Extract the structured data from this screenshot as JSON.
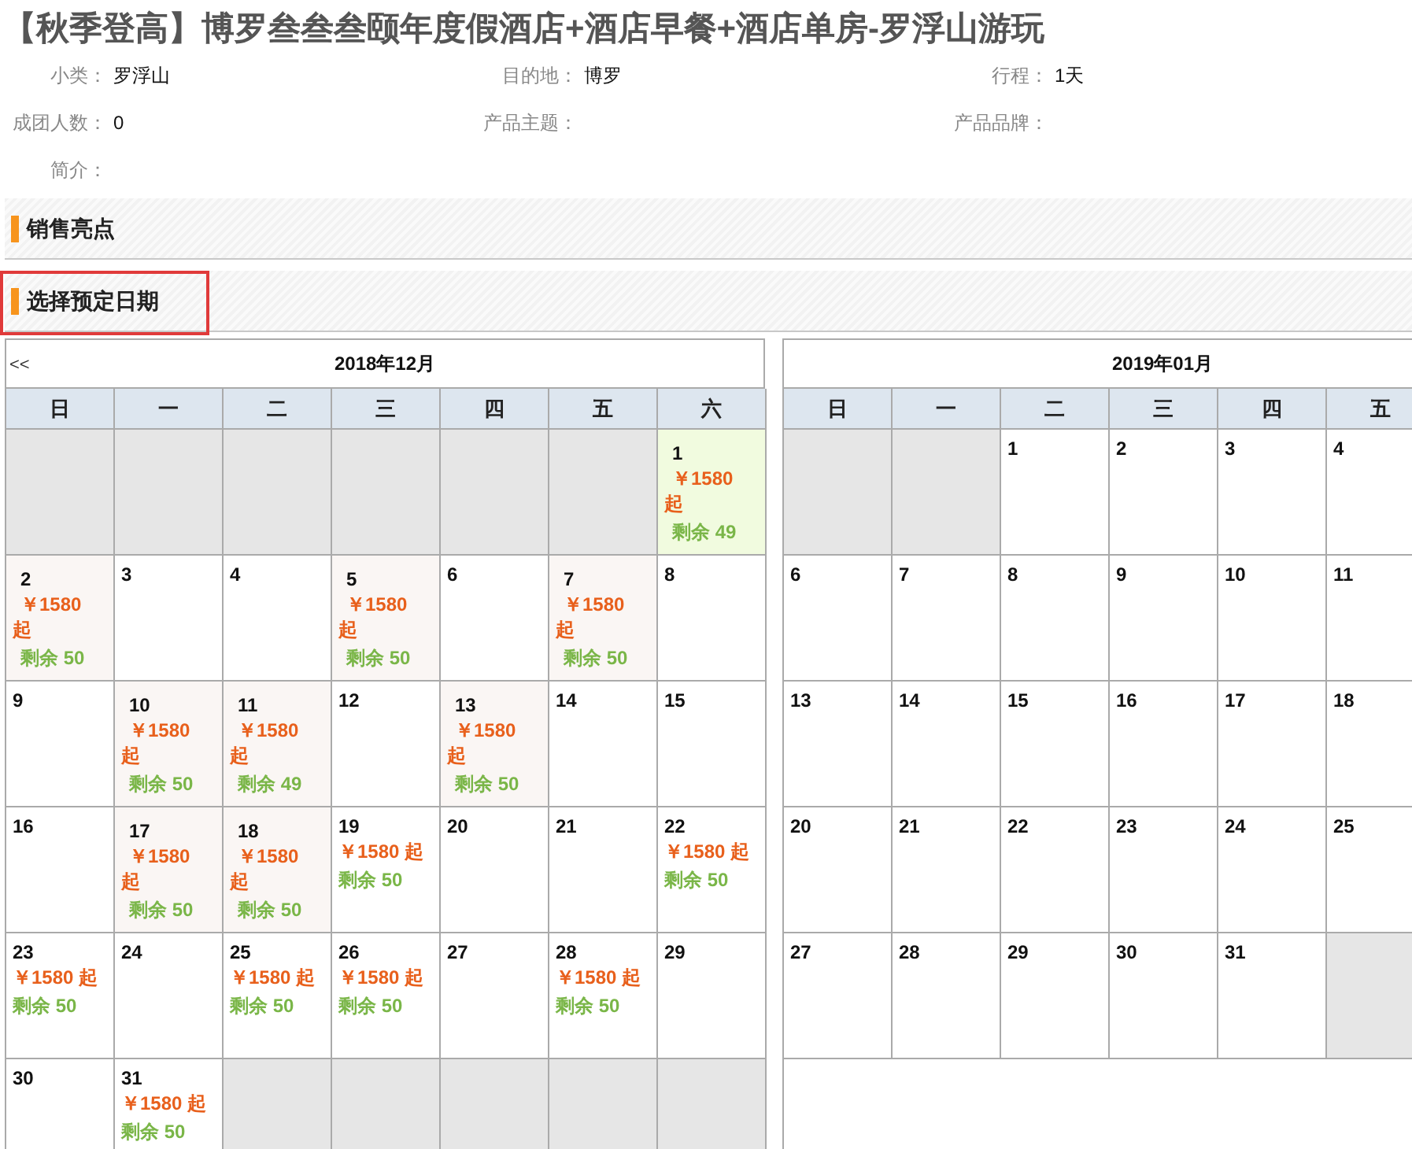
{
  "title": "【秋季登高】博罗叁叁叁颐年度假酒店+酒店早餐+酒店单房-罗浮山游玩",
  "info_rows": [
    [
      {
        "label": "小类：",
        "value": "罗浮山"
      },
      {
        "label": "目的地：",
        "value": "博罗"
      },
      {
        "label": "行程：",
        "value": "1天"
      }
    ],
    [
      {
        "label": "成团人数：",
        "value": "0"
      },
      {
        "label": "产品主题："
      },
      {
        "label": "产品品牌："
      }
    ],
    [
      {
        "label": "简介："
      }
    ]
  ],
  "sections": [
    {
      "title": "销售亮点",
      "highlighted": false
    },
    {
      "title": "选择预定日期",
      "highlighted": true
    }
  ],
  "calendars": [
    {
      "prev": "<<",
      "month": "2018年12月",
      "weekdays": [
        "日",
        "一",
        "二",
        "三",
        "四",
        "五",
        "六"
      ],
      "weeks": [
        [
          {
            "kind": "blank"
          },
          {
            "kind": "blank"
          },
          {
            "kind": "blank"
          },
          {
            "kind": "blank"
          },
          {
            "kind": "blank"
          },
          {
            "kind": "blank"
          },
          {
            "kind": "offer_boxed",
            "day": "1",
            "price": "￥1580 起",
            "stock": "剩余 49",
            "selected": true
          }
        ],
        [
          {
            "kind": "offer_boxed",
            "day": "2",
            "price": "￥1580 起",
            "stock": "剩余 50",
            "selected": false
          },
          {
            "kind": "day",
            "day": "3"
          },
          {
            "kind": "day",
            "day": "4"
          },
          {
            "kind": "offer_boxed",
            "day": "5",
            "price": "￥1580 起",
            "stock": "剩余 50",
            "selected": false
          },
          {
            "kind": "day",
            "day": "6"
          },
          {
            "kind": "offer_boxed",
            "day": "7",
            "price": "￥1580 起",
            "stock": "剩余 50",
            "selected": false
          },
          {
            "kind": "day",
            "day": "8"
          }
        ],
        [
          {
            "kind": "day",
            "day": "9"
          },
          {
            "kind": "offer_boxed",
            "day": "10",
            "price": "￥1580 起",
            "stock": "剩余 50",
            "selected": false
          },
          {
            "kind": "offer_boxed",
            "day": "11",
            "price": "￥1580 起",
            "stock": "剩余 49",
            "selected": false
          },
          {
            "kind": "day",
            "day": "12"
          },
          {
            "kind": "offer_boxed",
            "day": "13",
            "price": "￥1580 起",
            "stock": "剩余 50",
            "selected": false
          },
          {
            "kind": "day",
            "day": "14"
          },
          {
            "kind": "day",
            "day": "15"
          }
        ],
        [
          {
            "kind": "day",
            "day": "16"
          },
          {
            "kind": "offer_boxed",
            "day": "17",
            "price": "￥1580 起",
            "stock": "剩余 50",
            "selected": false
          },
          {
            "kind": "offer_boxed",
            "day": "18",
            "price": "￥1580 起",
            "stock": "剩余 50",
            "selected": false
          },
          {
            "kind": "offer",
            "day": "19",
            "price": "￥1580 起",
            "stock": "剩余 50",
            "selected": false
          },
          {
            "kind": "day",
            "day": "20"
          },
          {
            "kind": "day",
            "day": "21"
          },
          {
            "kind": "offer",
            "day": "22",
            "price": "￥1580 起",
            "stock": "剩余 50",
            "selected": false
          }
        ],
        [
          {
            "kind": "offer",
            "day": "23",
            "price": "￥1580 起",
            "stock": "剩余 50",
            "selected": false
          },
          {
            "kind": "day",
            "day": "24"
          },
          {
            "kind": "offer",
            "day": "25",
            "price": "￥1580 起",
            "stock": "剩余 50",
            "selected": false
          },
          {
            "kind": "offer",
            "day": "26",
            "price": "￥1580 起",
            "stock": "剩余 50",
            "selected": false
          },
          {
            "kind": "day",
            "day": "27"
          },
          {
            "kind": "offer",
            "day": "28",
            "price": "￥1580 起",
            "stock": "剩余 50",
            "selected": false
          },
          {
            "kind": "day",
            "day": "29"
          }
        ],
        [
          {
            "kind": "day",
            "day": "30"
          },
          {
            "kind": "offer",
            "day": "31",
            "price": "￥1580 起",
            "stock": "剩余 50",
            "selected": false
          },
          {
            "kind": "blank"
          },
          {
            "kind": "blank"
          },
          {
            "kind": "blank"
          },
          {
            "kind": "blank"
          },
          {
            "kind": "blank"
          }
        ]
      ]
    },
    {
      "month": "2019年01月",
      "weekdays": [
        "日",
        "一",
        "二",
        "三",
        "四",
        "五"
      ],
      "weeks": [
        [
          {
            "kind": "blank"
          },
          {
            "kind": "blank"
          },
          {
            "kind": "day",
            "day": "1"
          },
          {
            "kind": "day",
            "day": "2"
          },
          {
            "kind": "day",
            "day": "3"
          },
          {
            "kind": "day",
            "day": "4"
          }
        ],
        [
          {
            "kind": "day",
            "day": "6"
          },
          {
            "kind": "day",
            "day": "7"
          },
          {
            "kind": "day",
            "day": "8"
          },
          {
            "kind": "day",
            "day": "9"
          },
          {
            "kind": "day",
            "day": "10"
          },
          {
            "kind": "day",
            "day": "11"
          }
        ],
        [
          {
            "kind": "day",
            "day": "13"
          },
          {
            "kind": "day",
            "day": "14"
          },
          {
            "kind": "day",
            "day": "15"
          },
          {
            "kind": "day",
            "day": "16"
          },
          {
            "kind": "day",
            "day": "17"
          },
          {
            "kind": "day",
            "day": "18"
          }
        ],
        [
          {
            "kind": "day",
            "day": "20"
          },
          {
            "kind": "day",
            "day": "21"
          },
          {
            "kind": "day",
            "day": "22"
          },
          {
            "kind": "day",
            "day": "23"
          },
          {
            "kind": "day",
            "day": "24"
          },
          {
            "kind": "day",
            "day": "25"
          }
        ],
        [
          {
            "kind": "day",
            "day": "27"
          },
          {
            "kind": "day",
            "day": "28"
          },
          {
            "kind": "day",
            "day": "29"
          },
          {
            "kind": "day",
            "day": "30"
          },
          {
            "kind": "day",
            "day": "31"
          },
          {
            "kind": "blank"
          }
        ]
      ]
    }
  ]
}
